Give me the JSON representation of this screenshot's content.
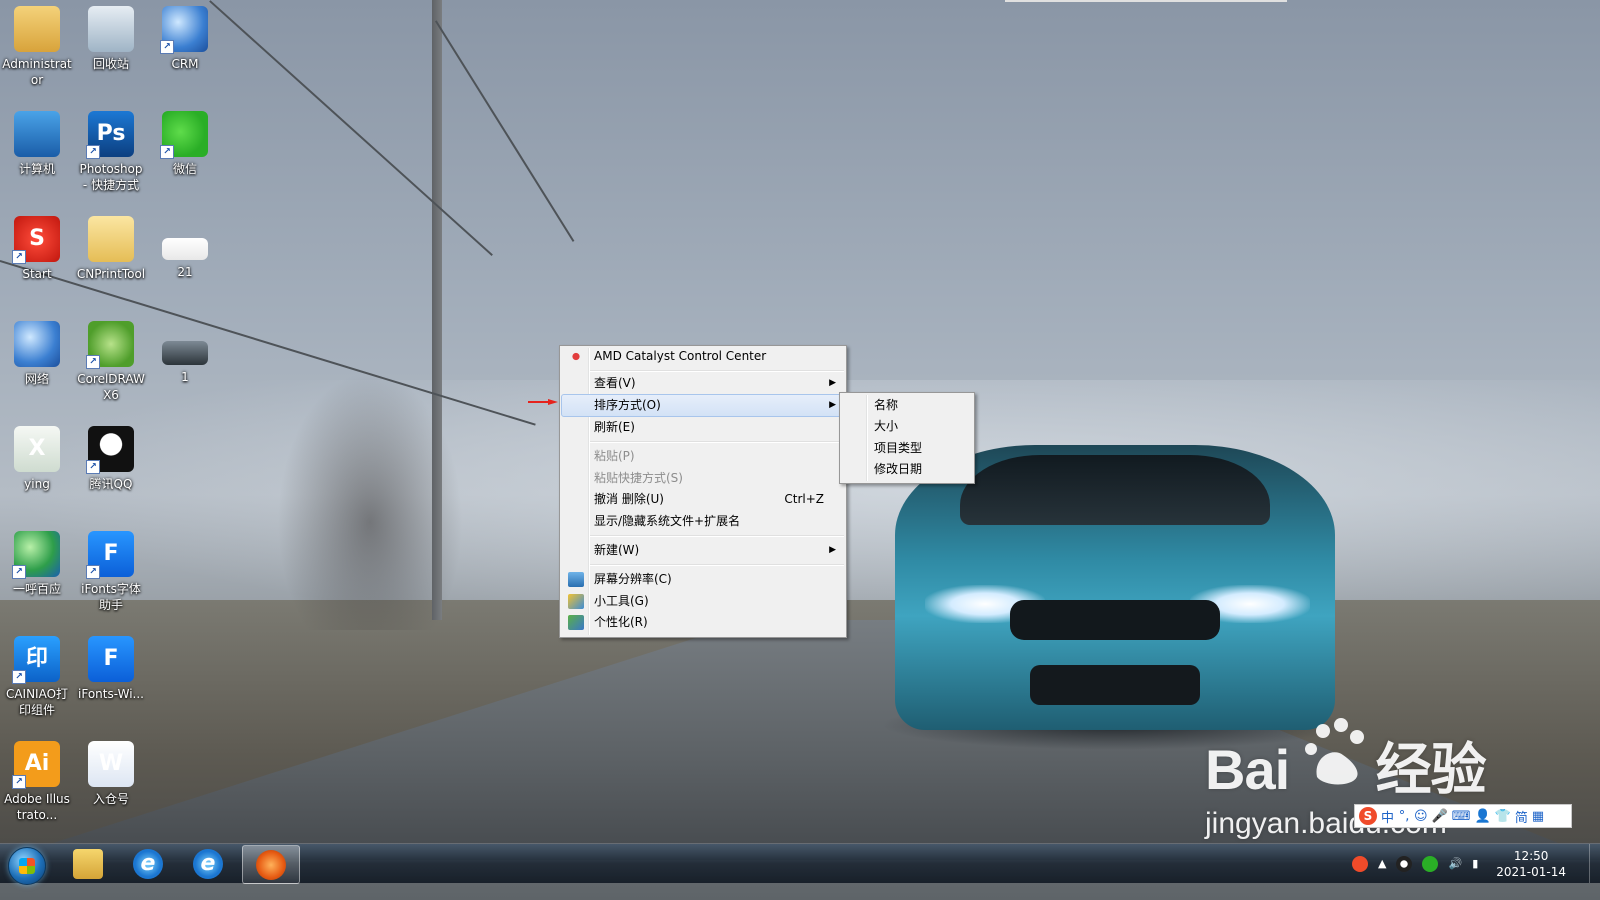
{
  "desktop": {
    "icons": [
      {
        "label": "Administrator",
        "glyph": "",
        "icon": "user-folder-icon"
      },
      {
        "label": "回收站",
        "glyph": "",
        "icon": "recycle-bin-icon"
      },
      {
        "label": "CRM",
        "glyph": "",
        "icon": "globe-icon"
      },
      {
        "label": "计算机",
        "glyph": "",
        "icon": "computer-icon"
      },
      {
        "label": "Photoshop - 快捷方式",
        "glyph": "Ps",
        "icon": "photoshop-icon"
      },
      {
        "label": "微信",
        "glyph": "",
        "icon": "wechat-icon"
      },
      {
        "label": "Start",
        "glyph": "S",
        "icon": "start-app-icon"
      },
      {
        "label": "CNPrintTool",
        "glyph": "",
        "icon": "folder-icon"
      },
      {
        "label": "21",
        "glyph": "",
        "icon": "image-file-icon"
      },
      {
        "label": "网络",
        "glyph": "",
        "icon": "network-icon"
      },
      {
        "label": "CorelDRAW X6",
        "glyph": "",
        "icon": "coreldraw-icon"
      },
      {
        "label": "1",
        "glyph": "",
        "icon": "image-file-icon"
      },
      {
        "label": "ying",
        "glyph": "X",
        "icon": "excel-file-icon"
      },
      {
        "label": "腾讯QQ",
        "glyph": "",
        "icon": "qq-icon"
      },
      {
        "label": "一呼百应",
        "glyph": "",
        "icon": "earth-icon"
      },
      {
        "label": "iFonts字体助手",
        "glyph": "F",
        "icon": "ifonts-icon"
      },
      {
        "label": "CAINIAO打印组件",
        "glyph": "印",
        "icon": "cainiao-icon"
      },
      {
        "label": "iFonts-Wi...",
        "glyph": "F",
        "icon": "ifonts-icon"
      },
      {
        "label": "Adobe Illustrato...",
        "glyph": "Ai",
        "icon": "illustrator-icon"
      },
      {
        "label": "入仓号",
        "glyph": "W",
        "icon": "word-file-icon"
      }
    ]
  },
  "context_menu": {
    "amd": "AMD Catalyst Control Center",
    "view": "查看(V)",
    "sort": "排序方式(O)",
    "refresh": "刷新(E)",
    "paste": "粘贴(P)",
    "paste_shortcut": "粘贴快捷方式(S)",
    "undo": "撤消 删除(U)",
    "undo_accel": "Ctrl+Z",
    "show_hide": "显示/隐藏系统文件+扩展名",
    "new": "新建(W)",
    "resolution": "屏幕分辨率(C)",
    "gadgets": "小工具(G)",
    "personalize": "个性化(R)"
  },
  "sort_submenu": {
    "name": "名称",
    "size": "大小",
    "type": "项目类型",
    "date": "修改日期"
  },
  "watermark": {
    "brand_left": "Bai",
    "brand_right": "经验",
    "url": "jingyan.baidu.com"
  },
  "ime_bar": {
    "logo": "S",
    "items": [
      "中",
      "°,",
      "☺",
      "🎤",
      "⌨",
      "👤",
      "👕",
      "简",
      "▦"
    ]
  },
  "taskbar": {
    "clock_time": "12:50",
    "clock_date": "2021-01-14",
    "ie_glyph": "e"
  }
}
